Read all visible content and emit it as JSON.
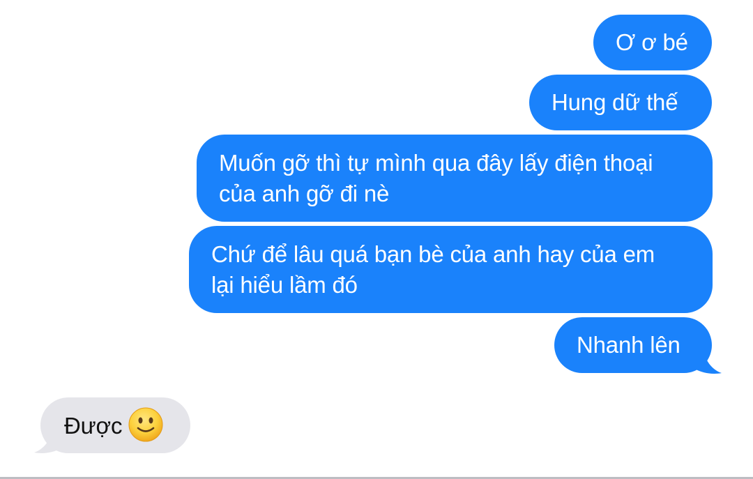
{
  "conversation": {
    "sent_messages": [
      {
        "lines": [
          "Ơ ơ bé"
        ]
      },
      {
        "lines": [
          "Hung dữ thế"
        ]
      },
      {
        "lines": [
          "Muốn gỡ thì tự mình qua đây lấy điện thoại",
          "của anh gỡ đi nè"
        ]
      },
      {
        "lines": [
          "Chứ để lâu quá bạn bè của anh hay của em",
          "lại hiểu lầm đó"
        ]
      },
      {
        "lines": [
          "Nhanh lên"
        ]
      }
    ],
    "received_messages": [
      {
        "text": "Được",
        "emoji": "slightly-smiling-face-icon"
      }
    ]
  },
  "colors": {
    "sent_bubble": "#1a82fb",
    "received_bubble": "#e5e5ea",
    "sent_text": "#ffffff",
    "received_text": "#000000"
  }
}
